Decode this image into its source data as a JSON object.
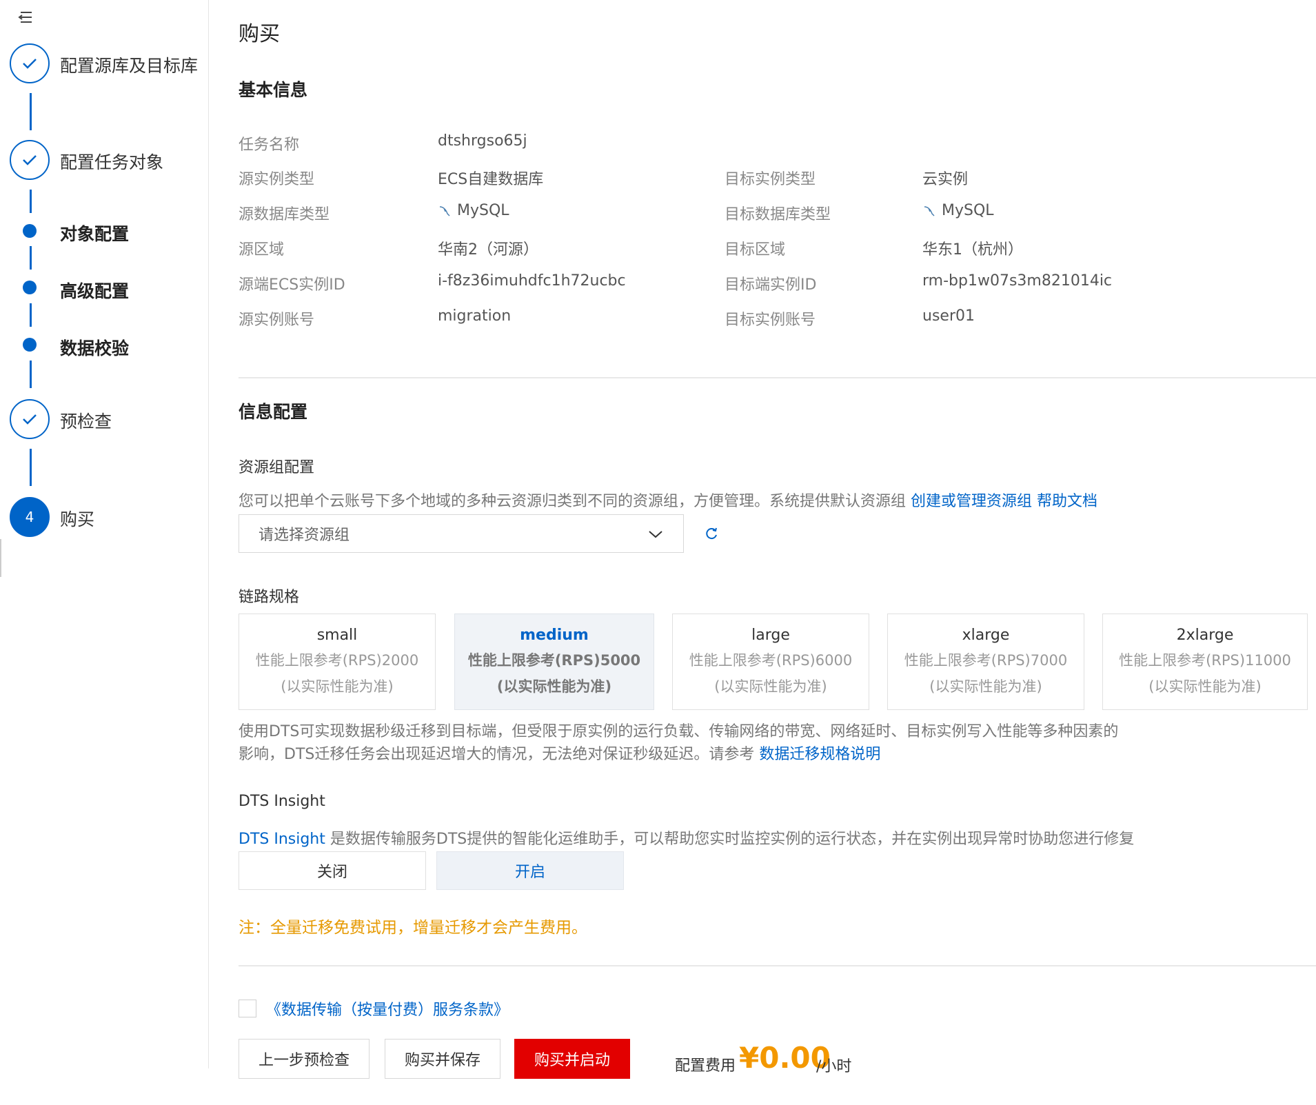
{
  "sidebar": {
    "steps": [
      {
        "label": "配置源库及目标库",
        "state": "done"
      },
      {
        "label": "配置任务对象",
        "state": "done"
      },
      {
        "label": "对象配置",
        "state": "current-sub"
      },
      {
        "label": "高级配置",
        "state": "current-sub"
      },
      {
        "label": "数据校验",
        "state": "current-sub"
      },
      {
        "label": "预检查",
        "state": "done"
      },
      {
        "label": "购买",
        "state": "active",
        "number": "4"
      }
    ]
  },
  "page": {
    "title": "购买"
  },
  "basic_info": {
    "title": "基本信息",
    "task_name_label": "任务名称",
    "task_name_value": "dtshrgso65j",
    "rows": [
      {
        "src_label": "源实例类型",
        "src_value": "ECS自建数据库",
        "dst_label": "目标实例类型",
        "dst_value": "云实例"
      },
      {
        "src_label": "源数据库类型",
        "src_value": "MySQL",
        "dst_label": "目标数据库类型",
        "dst_value": "MySQL"
      },
      {
        "src_label": "源区域",
        "src_value": "华南2（河源）",
        "dst_label": "目标区域",
        "dst_value": "华东1（杭州）"
      },
      {
        "src_label": "源端ECS实例ID",
        "src_value": "i-f8z36imuhdfc1h72ucbc",
        "dst_label": "目标端实例ID",
        "dst_value": "rm-bp1w07s3m821014ic"
      },
      {
        "src_label": "源实例账号",
        "src_value": "migration",
        "dst_label": "目标实例账号",
        "dst_value": "user01"
      }
    ]
  },
  "config": {
    "title": "信息配置",
    "resource_group": {
      "title": "资源组配置",
      "desc": "您可以把单个云账号下多个地域的多种云资源归类到不同的资源组，方便管理。系统提供默认资源组",
      "link_manage": "创建或管理资源组",
      "link_help": "帮助文档",
      "placeholder": "请选择资源组"
    },
    "spec": {
      "title": "链路规格",
      "selected": "medium",
      "options": [
        {
          "name": "small",
          "line1": "性能上限参考(RPS)2000",
          "line2": "(以实际性能为准)"
        },
        {
          "name": "medium",
          "line1": "性能上限参考(RPS)5000",
          "line2": "(以实际性能为准)"
        },
        {
          "name": "large",
          "line1": "性能上限参考(RPS)6000",
          "line2": "(以实际性能为准)"
        },
        {
          "name": "xlarge",
          "line1": "性能上限参考(RPS)7000",
          "line2": "(以实际性能为准)"
        },
        {
          "name": "2xlarge",
          "line1": "性能上限参考(RPS)11000",
          "line2": "(以实际性能为准)"
        }
      ],
      "desc_line1": "使用DTS可实现数据秒级迁移到目标端，但受限于原实例的运行负载、传输网络的带宽、网络延时、目标实例写入性能等多种因素的",
      "desc_line2": "影响，DTS迁移任务会出现延迟增大的情况，无法绝对保证秒级延迟。请参考",
      "desc_link": "数据迁移规格说明"
    },
    "insight": {
      "title": "DTS Insight",
      "link": "DTS Insight",
      "desc": " 是数据传输服务DTS提供的智能化运维助手，可以帮助您实时监控实例的运行状态，并在实例出现异常时协助您进行修复",
      "off_label": "关闭",
      "on_label": "开启",
      "selected": "on"
    },
    "note": "注：全量迁移免费试用，增量迁移才会产生费用。"
  },
  "footer": {
    "terms": "《数据传输（按量付费）服务条款》",
    "terms_checked": false,
    "back_button": "上一步预检查",
    "save_button": "购买并保存",
    "start_button": "购买并启动",
    "cost_label": "配置费用",
    "cost_value": "¥0.00",
    "cost_unit": "/小时"
  },
  "colors": {
    "accent": "#0064c8",
    "danger": "#e20000",
    "price": "#f39800",
    "note": "#e69900"
  }
}
